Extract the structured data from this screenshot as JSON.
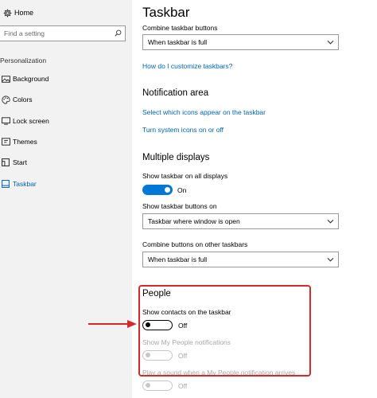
{
  "sidebar": {
    "home_label": "Home",
    "search_placeholder": "Find a setting",
    "section_label": "Personalization",
    "items": [
      {
        "label": "Background",
        "icon": "image-icon",
        "active": false
      },
      {
        "label": "Colors",
        "icon": "palette-icon",
        "active": false
      },
      {
        "label": "Lock screen",
        "icon": "lock-screen-icon",
        "active": false
      },
      {
        "label": "Themes",
        "icon": "themes-icon",
        "active": false
      },
      {
        "label": "Start",
        "icon": "start-icon",
        "active": false
      },
      {
        "label": "Taskbar",
        "icon": "taskbar-icon",
        "active": true
      }
    ]
  },
  "main": {
    "title": "Taskbar",
    "combine_label": "Combine taskbar buttons",
    "combine_value": "When taskbar is full",
    "customize_link": "How do I customize taskbars?",
    "notification": {
      "heading": "Notification area",
      "link1": "Select which icons appear on the taskbar",
      "link2": "Turn system icons on or off"
    },
    "multiple": {
      "heading": "Multiple displays",
      "show_all_label": "Show taskbar on all displays",
      "show_all_state": "On",
      "buttons_on_label": "Show taskbar buttons on",
      "buttons_on_value": "Taskbar where window is open",
      "combine_other_label": "Combine buttons on other taskbars",
      "combine_other_value": "When taskbar is full"
    },
    "people": {
      "heading": "People",
      "contacts_label": "Show contacts on the taskbar",
      "contacts_state": "Off",
      "notif_label": "Show My People notifications",
      "notif_state": "Off",
      "sound_label": "Play a sound when a My People notification arrives",
      "sound_state": "Off"
    }
  },
  "colors": {
    "accent": "#0078d7",
    "link": "#0063b1",
    "highlight": "#d62a2a"
  }
}
